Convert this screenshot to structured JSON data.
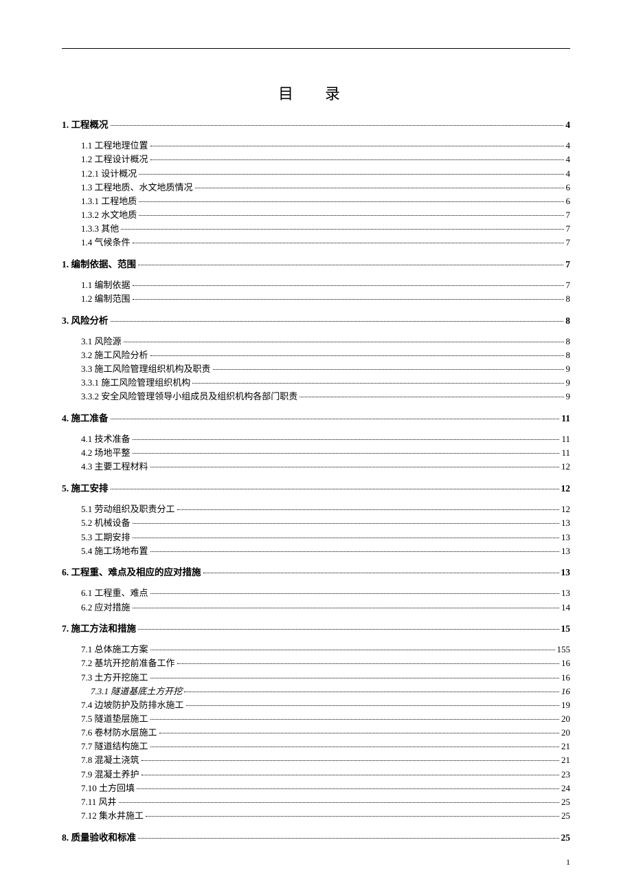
{
  "title": "目  录",
  "page_number": "1",
  "toc": [
    {
      "level": "sec",
      "label": "1. 工程概况",
      "page": "4"
    },
    {
      "level": "sub",
      "label": "1.1 工程地理位置",
      "page": "4"
    },
    {
      "level": "sub",
      "label": "1.2 工程设计概况",
      "page": "4"
    },
    {
      "level": "sub",
      "label": "1.2.1 设计概况",
      "page": "4"
    },
    {
      "level": "sub",
      "label": "1.3 工程地质、水文地质情况",
      "page": "6"
    },
    {
      "level": "sub",
      "label": "1.3.1 工程地质",
      "page": "6"
    },
    {
      "level": "sub",
      "label": "1.3.2 水文地质",
      "page": "7"
    },
    {
      "level": "sub",
      "label": "1.3.3 其他",
      "page": "7"
    },
    {
      "level": "sub",
      "label": "1.4 气候条件",
      "page": "7"
    },
    {
      "level": "sec",
      "label": "1. 编制依据、范围",
      "page": "7"
    },
    {
      "level": "sub",
      "label": "1.1 编制依据",
      "page": "7"
    },
    {
      "level": "sub",
      "label": "1.2 编制范围",
      "page": "8"
    },
    {
      "level": "sec",
      "label": "3. 风险分析",
      "page": "8"
    },
    {
      "level": "sub",
      "label": "3.1 风险源",
      "page": "8"
    },
    {
      "level": "sub",
      "label": "3.2 施工风险分析",
      "page": "8"
    },
    {
      "level": "sub",
      "label": "3.3 施工风险管理组织机构及职责",
      "page": "9"
    },
    {
      "level": "sub",
      "label": "3.3.1 施工风险管理组织机构",
      "page": "9"
    },
    {
      "level": "sub",
      "label": "3.3.2 安全风险管理领导小组成员及组织机构各部门职责",
      "page": "9"
    },
    {
      "level": "sec",
      "label": "4. 施工准备",
      "page": "11"
    },
    {
      "level": "sub",
      "label": "4.1 技术准备",
      "page": "11"
    },
    {
      "level": "sub",
      "label": "4.2 场地平整",
      "page": "11"
    },
    {
      "level": "sub",
      "label": "4.3 主要工程材料",
      "page": "12"
    },
    {
      "level": "sec",
      "label": "5. 施工安排",
      "page": "12"
    },
    {
      "level": "sub",
      "label": "5.1 劳动组织及职责分工",
      "page": "12"
    },
    {
      "level": "sub",
      "label": "5.2 机械设备",
      "page": "13"
    },
    {
      "level": "sub",
      "label": "5.3 工期安排",
      "page": "13"
    },
    {
      "level": "sub",
      "label": "5.4 施工场地布置",
      "page": "13"
    },
    {
      "level": "sec",
      "label": "6. 工程重、难点及相应的应对措施",
      "page": "13"
    },
    {
      "level": "sub",
      "label": "6.1 工程重、难点",
      "page": "13"
    },
    {
      "level": "sub",
      "label": "6.2 应对措施",
      "page": "14"
    },
    {
      "level": "sec",
      "label": "7. 施工方法和措施",
      "page": "15"
    },
    {
      "level": "sub",
      "label": "7.1 总体施工方案",
      "page": "155"
    },
    {
      "level": "sub",
      "label": "7.2 基坑开挖前准备工作",
      "page": "16"
    },
    {
      "level": "sub",
      "label": "7.3 土方开挖施工",
      "page": "16"
    },
    {
      "level": "subsub",
      "label": "7.3.1 隧道基底土方开挖",
      "page": "16",
      "italic": true
    },
    {
      "level": "sub",
      "label": "7.4 边坡防护及防排水施工",
      "page": "19"
    },
    {
      "level": "sub",
      "label": "7.5 隧道垫层施工",
      "page": "20"
    },
    {
      "level": "sub",
      "label": "7.6 卷材防水层施工",
      "page": "20"
    },
    {
      "level": "sub",
      "label": "7.7 隧道结构施工",
      "page": "21"
    },
    {
      "level": "sub",
      "label": "7.8 混凝土浇筑",
      "page": "21"
    },
    {
      "level": "sub",
      "label": "7.9 混凝土养护",
      "page": "23"
    },
    {
      "level": "sub",
      "label": "7.10 土方回填",
      "page": "24"
    },
    {
      "level": "sub",
      "label": "7.11 风井",
      "page": "25"
    },
    {
      "level": "sub",
      "label": "7.12 集水井施工",
      "page": "25"
    },
    {
      "level": "sec",
      "label": "8. 质量验收和标准",
      "page": "25"
    }
  ]
}
